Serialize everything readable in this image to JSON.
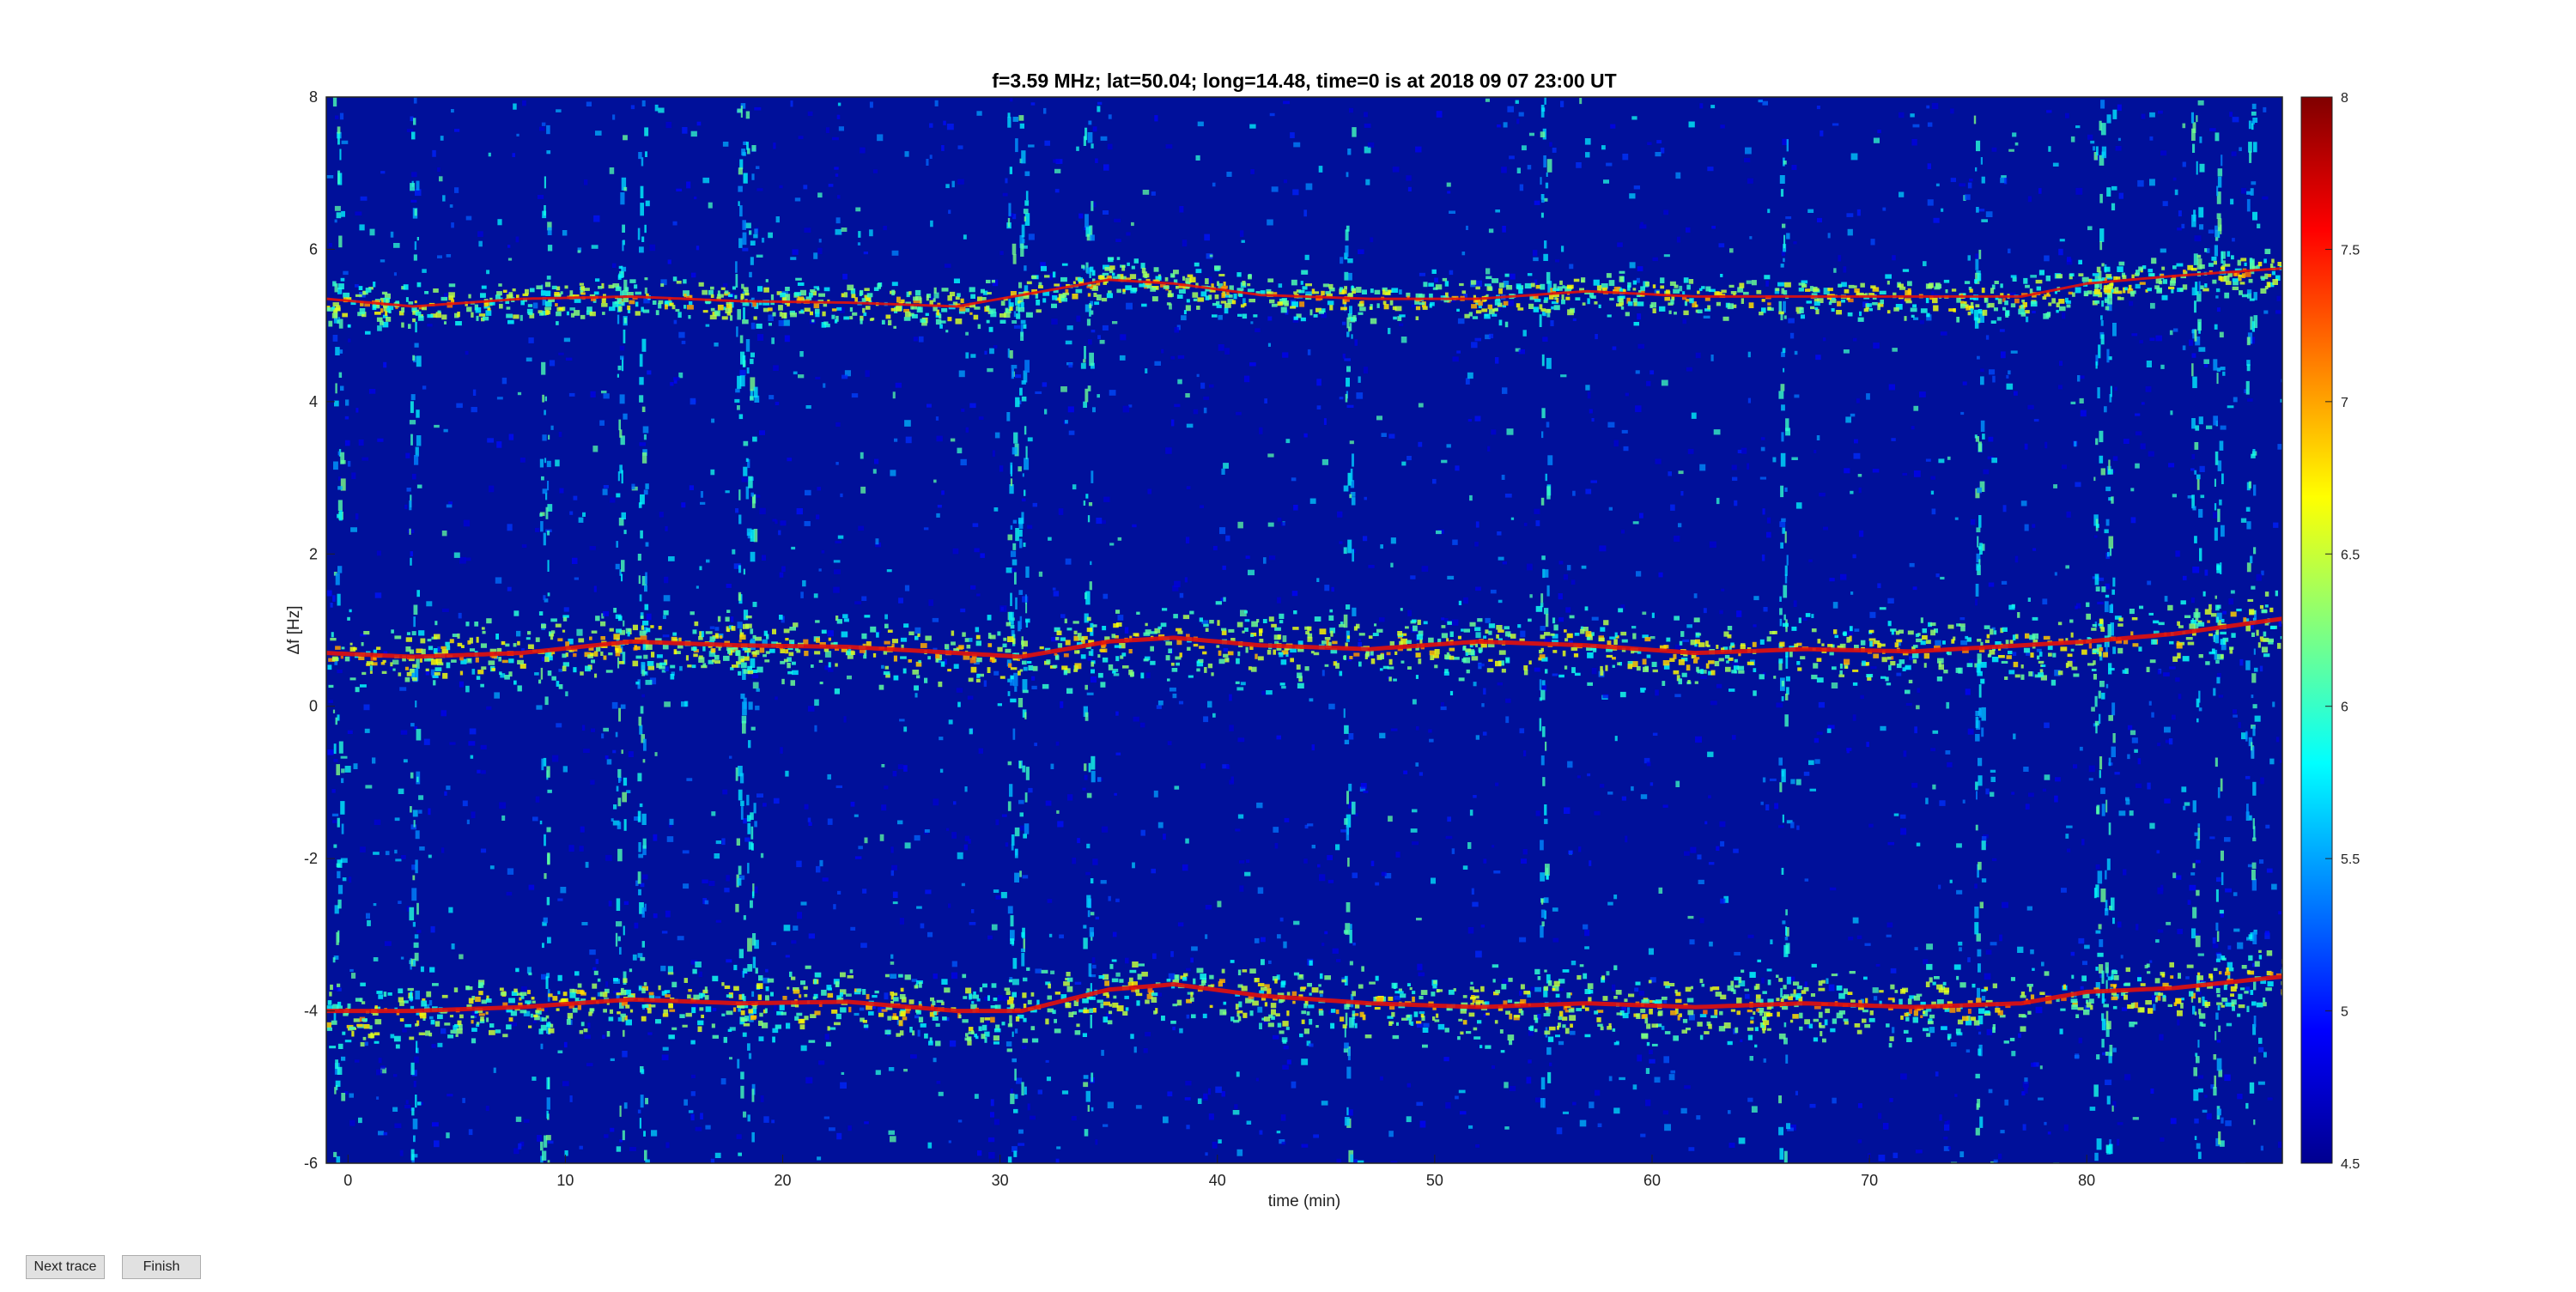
{
  "chart_data": {
    "type": "heatmap",
    "title": "f=3.59 MHz;  lat=50.04; long=14.48, time=0 is at 2018 09 07 23:00 UT",
    "xlabel": "time (min)",
    "ylabel": "Δf [Hz]",
    "xlim": [
      -1,
      89
    ],
    "ylim": [
      -6,
      8
    ],
    "x_ticks": [
      0,
      10,
      20,
      30,
      40,
      50,
      60,
      70,
      80
    ],
    "y_ticks": [
      -6,
      -4,
      -2,
      0,
      2,
      4,
      6,
      8
    ],
    "colorbar": {
      "range": [
        4.5,
        8
      ],
      "ticks": [
        4.5,
        5,
        5.5,
        6,
        6.5,
        7,
        7.5,
        8
      ],
      "colormap": "jet"
    },
    "traces": [
      {
        "x": [
          -1,
          3,
          8,
          13,
          18,
          23,
          28,
          31,
          35,
          38,
          42,
          47,
          52,
          57,
          62,
          67,
          72,
          77,
          80,
          84,
          89
        ],
        "y": [
          5.35,
          5.25,
          5.35,
          5.38,
          5.32,
          5.3,
          5.25,
          5.4,
          5.6,
          5.55,
          5.4,
          5.35,
          5.35,
          5.45,
          5.38,
          5.38,
          5.38,
          5.38,
          5.55,
          5.65,
          5.75
        ]
      },
      {
        "x": [
          -1,
          3,
          8,
          13,
          18,
          23,
          28,
          31,
          35,
          38,
          42,
          47,
          52,
          57,
          62,
          67,
          72,
          77,
          80,
          84,
          89
        ],
        "y": [
          0.7,
          0.65,
          0.7,
          0.85,
          0.8,
          0.78,
          0.7,
          0.65,
          0.85,
          0.9,
          0.8,
          0.75,
          0.85,
          0.8,
          0.7,
          0.75,
          0.72,
          0.8,
          0.85,
          0.95,
          1.15
        ]
      },
      {
        "x": [
          -1,
          3,
          8,
          13,
          18,
          23,
          28,
          31,
          35,
          38,
          42,
          47,
          52,
          57,
          62,
          67,
          72,
          77,
          80,
          84,
          89
        ],
        "y": [
          -4.0,
          -4.0,
          -3.95,
          -3.85,
          -3.9,
          -3.88,
          -4.0,
          -4.0,
          -3.72,
          -3.65,
          -3.8,
          -3.9,
          -3.95,
          -3.9,
          -3.95,
          -3.9,
          -3.95,
          -3.9,
          -3.75,
          -3.7,
          -3.55
        ]
      }
    ],
    "vertical_streaks_x": [
      -0.5,
      3,
      9,
      12.5,
      13.5,
      18,
      18.5,
      30.5,
      31,
      34,
      46,
      55,
      66,
      75,
      80.5,
      81,
      85,
      86,
      87.5
    ]
  },
  "buttons": {
    "next_trace": "Next trace",
    "finish": "Finish"
  }
}
